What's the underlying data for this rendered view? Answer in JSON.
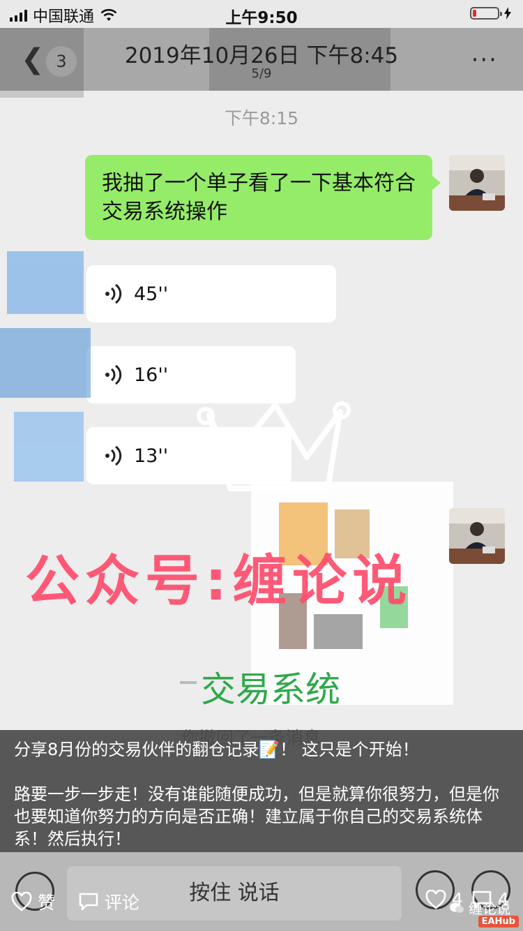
{
  "status_bar": {
    "carrier": "中国联通",
    "time": "上午9:50",
    "battery_level": 0.15,
    "battery_color": "#e02b2b"
  },
  "nav": {
    "back_count": "3",
    "title": "2019年10月26日 下午8:45",
    "subtitle": "5/9",
    "more": "···"
  },
  "chat": {
    "timestamp": "下午8:15",
    "text_message": "我抽了一个单子看了一下基本符合交易系统操作",
    "voice_messages": [
      {
        "duration": "45''"
      },
      {
        "duration": "16''"
      },
      {
        "duration": "13''"
      }
    ],
    "revoked_notice": "你撤回了一条消息"
  },
  "watermark": {
    "title": "公众号:缠论说",
    "subtitle": "交易系统",
    "title_color": "#ff4d6d",
    "subtitle_color": "#2fa84a"
  },
  "caption": {
    "line1": "分享8月份的交易伙伴的翻仓记录📝！ 这只是个开始！",
    "line2": "路要一步一步走！没有谁能随便成功，但是就算你很努力，但是你也要知道你努力的方向是否正确！建立属于你自己的交易系统体系！然后执行！"
  },
  "input_bar": {
    "hold_to_talk": "按住 说话"
  },
  "actions": {
    "like_label": "赞",
    "comment_label": "评论",
    "like_count": "4",
    "comment_count": "4"
  },
  "brand": {
    "name": "缠论说",
    "badge": "EAHub"
  },
  "colors": {
    "green_bubble": "#95ec69",
    "navbar": "#a8a8a8"
  }
}
